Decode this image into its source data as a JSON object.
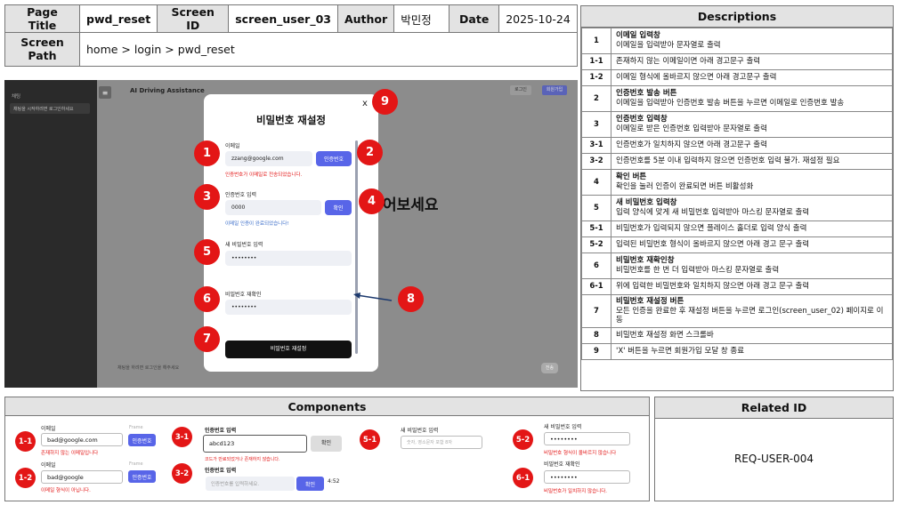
{
  "header": {
    "page_title_label": "Page Title",
    "page_title_value": "pwd_reset",
    "screen_id_label": "Screen ID",
    "screen_id_value": "screen_user_03",
    "author_label": "Author",
    "author_value": "박민정",
    "date_label": "Date",
    "date_value": "2025-10-24",
    "screen_path_label": "Screen Path",
    "screen_path_value": "home > login > pwd_reset"
  },
  "descriptions": {
    "title": "Descriptions",
    "rows": [
      {
        "id": "1",
        "title": "이메일 입력창",
        "text": "이메일을 입력받아 문자열로 출력"
      },
      {
        "id": "1-1",
        "title": "",
        "text": "존재하지 않는 이메일이면 아래 경고문구 출력"
      },
      {
        "id": "1-2",
        "title": "",
        "text": "이메일 형식에 올바르지 않으면 아래 경고문구 출력"
      },
      {
        "id": "2",
        "title": "인증번호 발송 버튼",
        "text": "이메일을 입력받아 인증번호 발송 버튼을 누르면 이메일로 인증번호 발송"
      },
      {
        "id": "3",
        "title": "인증번호 입력창",
        "text": "이메일로 받은 인증번호 입력받아 문자열로 출력"
      },
      {
        "id": "3-1",
        "title": "",
        "text": "인증번호가 일치하지 않으면 아래 경고문구 출력"
      },
      {
        "id": "3-2",
        "title": "",
        "text": "인증번호를 5분 이내 입력하지 않으면 인증번호 입력 불가. 재설정 필요"
      },
      {
        "id": "4",
        "title": "확인 버튼",
        "text": "확인을 눌러 인증이 완료되면 버튼 비활성화"
      },
      {
        "id": "5",
        "title": "새 비밀번호 입력창",
        "text": "입력 양식에 맞게 새 비밀번호 입력받아 마스킹 문자열로 출력"
      },
      {
        "id": "5-1",
        "title": "",
        "text": "비밀번호가 입력되지 않으면 플레이스 홀더로 입력 양식 출력"
      },
      {
        "id": "5-2",
        "title": "",
        "text": "입력된 비밀번호 형식이 올바르지 않으면 아래 경고 문구 출력"
      },
      {
        "id": "6",
        "title": "비밀번호 재확인창",
        "text": "비밀번호를 한 번 더 입력받아 마스킹 문자열로 출력"
      },
      {
        "id": "6-1",
        "title": "",
        "text": "위에 입력한 비밀번호와 일치하지 않으면 아래 경고 문구 출력"
      },
      {
        "id": "7",
        "title": "비밀번호 재설정 버튼",
        "text": "모든 인증을 완료한 후 재설정 버튼을 누르면 로그인(screen_user_02) 페이지로 이동"
      },
      {
        "id": "8",
        "title": "",
        "text": "비밀번호 재설정 화면 스크롤바"
      },
      {
        "id": "9",
        "title": "",
        "text": "'X' 버튼을 누르면 회원가입 모달 창 종료"
      }
    ]
  },
  "screen": {
    "app_title": "AI Driving Assistance",
    "sidebar_label": "채팅",
    "sidebar_item": "채팅을 시작하려면 로그인하세요",
    "header_btn_1": "로그인",
    "header_btn_2": "회원가입",
    "bg_text": "어보세요",
    "bottom_hint": "채팅을 하려면 로그인을 해주세요",
    "send_btn": "전송",
    "modal": {
      "title": "비밀번호 재설정",
      "close": "x",
      "email_label": "이메일",
      "email_value": "zzang@google.com",
      "send_btn": "인증번호",
      "email_error": "인증번호가 이메일로 전송되었습니다.",
      "code_label": "인증번호 입력",
      "code_value": "0000",
      "confirm_btn": "확인",
      "code_info": "이메일 인증이 완료되었습니다!",
      "new_pw_label": "새 비밀번호 입력",
      "new_pw_value": "••••••••",
      "confirm_pw_label": "비밀번호 재확인",
      "confirm_pw_value": "••••••••",
      "submit_btn": "비밀번호 재설정"
    },
    "markers": [
      "1",
      "2",
      "3",
      "4",
      "5",
      "6",
      "7",
      "8",
      "9"
    ]
  },
  "components": {
    "title": "Components",
    "c11": {
      "id": "1-1",
      "label": "이메일",
      "value": "bad@google.com",
      "btn": "인증번호",
      "frame": "Frame",
      "error": "존재하지 않는 이메일입니다"
    },
    "c12": {
      "id": "1-2",
      "label": "이메일",
      "value": "bad@google",
      "btn": "인증번호",
      "frame": "Frame",
      "error": "이메일 형식이 아닙니다."
    },
    "c31": {
      "id": "3-1",
      "label": "인증번호 입력",
      "value": "abcd123",
      "btn": "확인",
      "error": "코드가 만료되었거나 존재하지 않습니다."
    },
    "c32": {
      "id": "3-2",
      "label": "인증번호 입력",
      "placeholder": "인증번호를 입력하세요.",
      "btn": "확인",
      "timer": "4:52"
    },
    "c51": {
      "id": "5-1",
      "label": "새 비밀번호 입력",
      "placeholder": "숫자, 영소문자 포함 8자"
    },
    "c52": {
      "id": "5-2",
      "label": "새 비밀번호 입력",
      "value": "••••••••",
      "error": "비밀번호 형식이 올바르지 않습니다"
    },
    "c61": {
      "id": "6-1",
      "label": "비밀번호 재확인",
      "value": "••••••••",
      "error": "비밀번호가 일치하지 않습니다."
    }
  },
  "related": {
    "title": "Related ID",
    "value": "REQ-USER-004"
  }
}
